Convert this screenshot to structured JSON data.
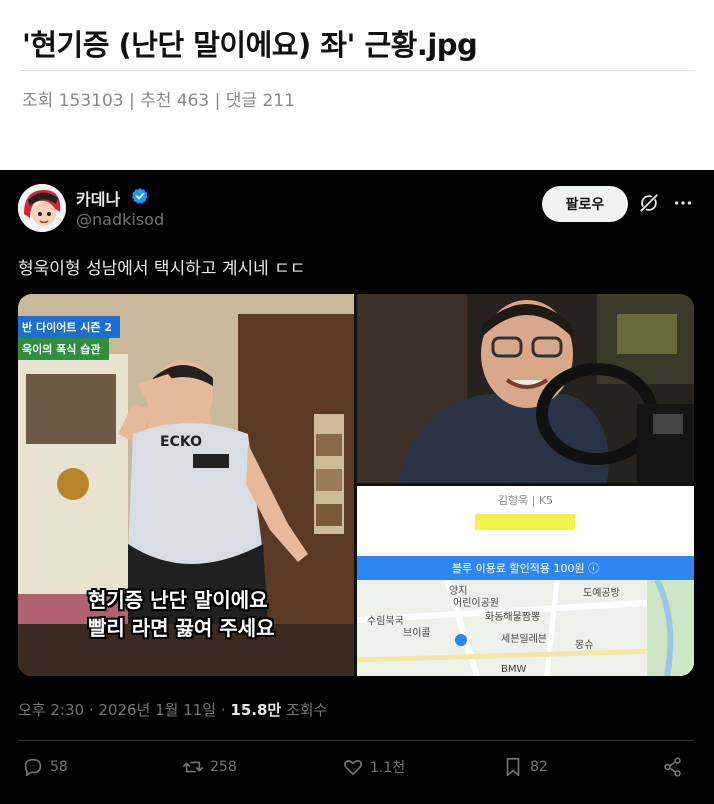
{
  "post": {
    "title": "'현기증 (난단 말이에요) 좌' 근황.jpg",
    "meta": "조회 153103 | 추천 463 | 댓글 211"
  },
  "tweet": {
    "display_name": "카데나",
    "handle": "@nadkisod",
    "follow_label": "팔로우",
    "text": "형욱이형 성남에서 택시하고 계시네 ㄷㄷ",
    "timestamp_prefix": "오후 2:30 · 2026년 1월 11일 · ",
    "views_count": "15.8만",
    "views_label": " 조회수",
    "actions": {
      "replies": "58",
      "retweets": "258",
      "likes": "1.1천",
      "bookmarks": "82"
    },
    "colors": {
      "background": "#000000",
      "verified": "#1d9bf0",
      "muted": "#71767b"
    }
  },
  "media": {
    "left_badge_1": "반 다이어트 시즌 2",
    "left_badge_2": "욱이의 폭식 습관",
    "subtitle_line_1": "현기증 난단 말이에요",
    "subtitle_line_2": "빨리 라면 끓여 주세요",
    "shirt_text": "ECKO",
    "driver_info": "김형욱 | K5",
    "discount_text": "블루 이용료 할인적용 100원 ⓘ",
    "map_labels": [
      "양지",
      "어린이공원",
      "화동해물짬뽕",
      "수림북국",
      "브이콜",
      "세븐일레븐",
      "몽슈",
      "도예공방",
      "BMW"
    ]
  }
}
